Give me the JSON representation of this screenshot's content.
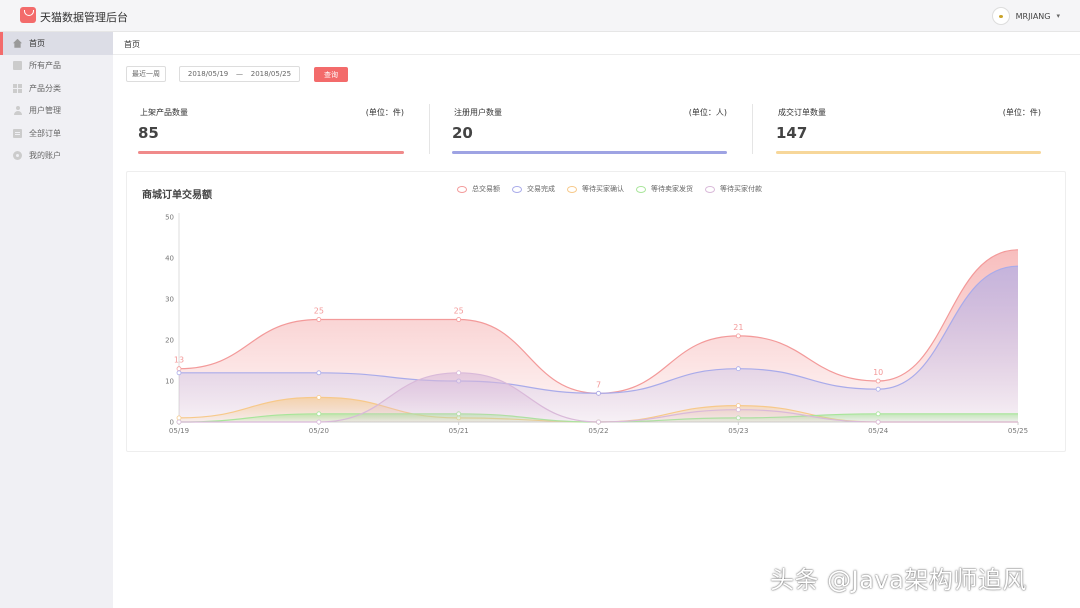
{
  "app": {
    "title": "天猫数据管理后台",
    "username": "MRJIANG",
    "caret": "▾"
  },
  "sidebar": {
    "items": [
      {
        "label": "首页",
        "icon": "home-icon",
        "active": true
      },
      {
        "label": "所有产品",
        "icon": "product-icon",
        "active": false
      },
      {
        "label": "产品分类",
        "icon": "category-icon",
        "active": false
      },
      {
        "label": "用户管理",
        "icon": "user-icon",
        "active": false
      },
      {
        "label": "全部订单",
        "icon": "order-icon",
        "active": false
      },
      {
        "label": "我的账户",
        "icon": "settings-icon",
        "active": false
      }
    ]
  },
  "breadcrumb": "首页",
  "filter": {
    "recent_week_label": "最近一周",
    "start_date": "2018/05/19",
    "separator": "—",
    "end_date": "2018/05/25",
    "query_label": "查询"
  },
  "stats": [
    {
      "title": "上架产品数量",
      "unit": "(单位：件)",
      "value": "85",
      "color": "#f08a8a"
    },
    {
      "title": "注册用户数量",
      "unit": "(单位：人)",
      "value": "20",
      "color": "#9ea3e3"
    },
    {
      "title": "成交订单数量",
      "unit": "(单位：件)",
      "value": "147",
      "color": "#f7d79a"
    }
  ],
  "chart_data": {
    "type": "area",
    "title": "商城订单交易额",
    "categories": [
      "05/19",
      "05/20",
      "05/21",
      "05/22",
      "05/23",
      "05/24",
      "05/25"
    ],
    "ylim": [
      0,
      50
    ],
    "yticks": [
      0,
      10,
      20,
      30,
      40,
      50
    ],
    "grid": false,
    "legend_position": "top",
    "series": [
      {
        "name": "总交易额",
        "values": [
          13,
          25,
          25,
          7,
          21,
          10,
          42
        ],
        "color": "#f39a9a",
        "show_labels": true
      },
      {
        "name": "交易完成",
        "values": [
          12,
          12,
          10,
          7,
          13,
          8,
          38
        ],
        "color": "#a9abea",
        "show_labels": false
      },
      {
        "name": "等待买家确认",
        "values": [
          1,
          6,
          1,
          0,
          4,
          0,
          0
        ],
        "color": "#f7c98a",
        "show_labels": false
      },
      {
        "name": "等待卖家发货",
        "values": [
          0,
          2,
          2,
          0,
          1,
          2,
          2
        ],
        "color": "#a8e59a",
        "show_labels": false
      },
      {
        "name": "等待买家付款",
        "values": [
          0,
          0,
          12,
          0,
          3,
          0,
          0
        ],
        "color": "#d9b9d9",
        "show_labels": false
      }
    ]
  },
  "watermark": "头条 @Java架构师追风"
}
